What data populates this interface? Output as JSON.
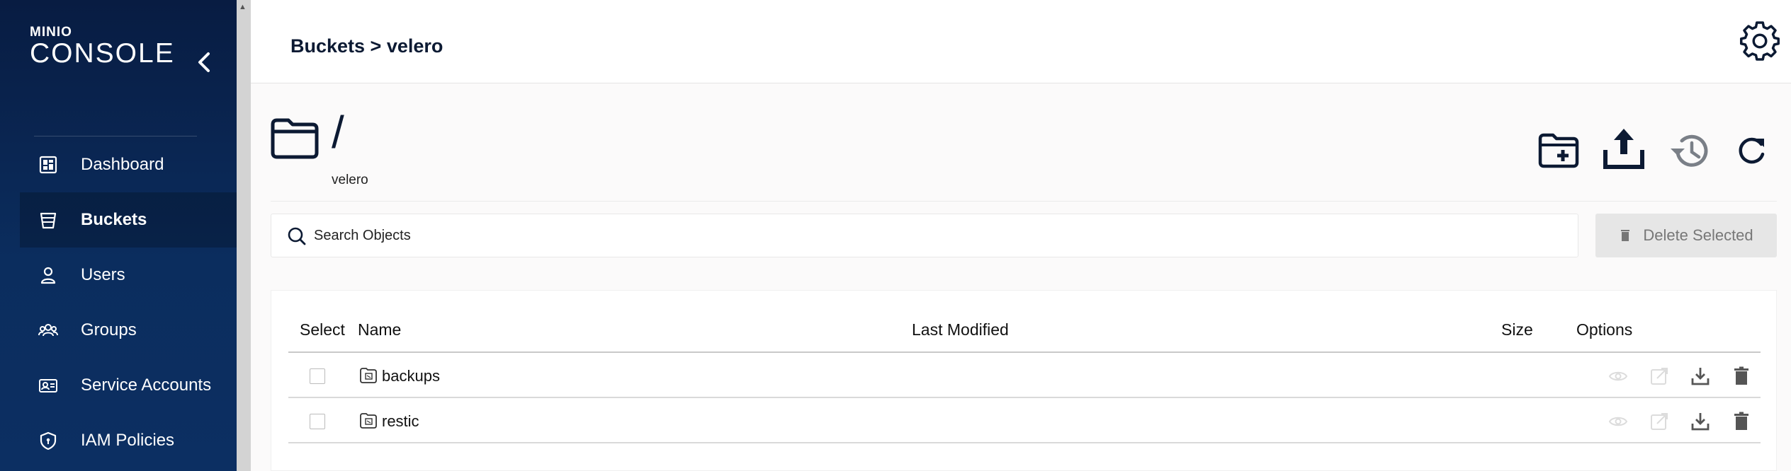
{
  "sidebar": {
    "logo_small": "MINIO",
    "logo_big": "CONSOLE",
    "items": [
      {
        "label": "Dashboard",
        "icon": "dashboard-icon"
      },
      {
        "label": "Buckets",
        "icon": "bucket-icon",
        "active": true
      },
      {
        "label": "Users",
        "icon": "user-icon"
      },
      {
        "label": "Groups",
        "icon": "groups-icon"
      },
      {
        "label": "Service Accounts",
        "icon": "service-accounts-icon"
      },
      {
        "label": "IAM Policies",
        "icon": "shield-icon"
      }
    ]
  },
  "header": {
    "breadcrumb": "Buckets > velero"
  },
  "browser": {
    "path": "/",
    "bucket": "velero"
  },
  "search": {
    "placeholder": "Search Objects"
  },
  "delete_selected_label": "Delete Selected",
  "table": {
    "columns": [
      "Select",
      "Name",
      "Last Modified",
      "Size",
      "Options"
    ],
    "rows": [
      {
        "name": "backups",
        "last_modified": "",
        "size": ""
      },
      {
        "name": "restic",
        "last_modified": "",
        "size": ""
      }
    ]
  },
  "colors": {
    "sidebar_top": "#081c42",
    "sidebar_bottom": "#0c2f62",
    "accent_dark": "#081c42"
  }
}
